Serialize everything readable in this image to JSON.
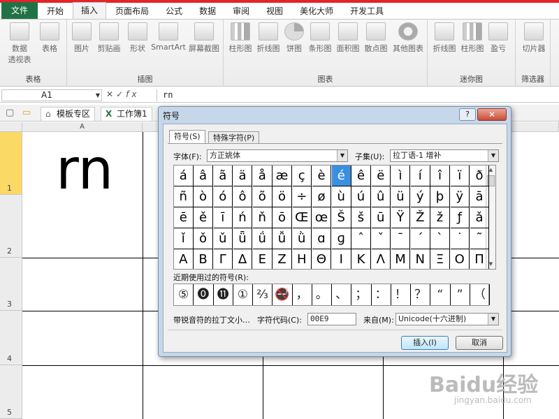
{
  "ribbon_tabs": [
    "文件",
    "开始",
    "插入",
    "页面布局",
    "公式",
    "数据",
    "审阅",
    "视图",
    "美化大师",
    "开发工具"
  ],
  "ribbon_groups": {
    "tables": {
      "label": "表格",
      "buttons": [
        "数据\n透视表",
        "表格"
      ]
    },
    "illustrations": {
      "label": "插图",
      "buttons": [
        "图片",
        "剪贴画",
        "形状",
        "SmartArt",
        "屏幕截图"
      ]
    },
    "charts": {
      "label": "图表",
      "buttons": [
        "柱形图",
        "折线图",
        "饼图",
        "条形图",
        "面积图",
        "散点图",
        "其他图表"
      ]
    },
    "sparklines": {
      "label": "迷你图",
      "buttons": [
        "折线图",
        "柱形图",
        "盈亏"
      ]
    },
    "filter": {
      "label": "筛选器",
      "buttons": [
        "切片器"
      ]
    }
  },
  "formula_bar": {
    "name_box": "A1",
    "fx": "fx",
    "value": "rn"
  },
  "tab_strip": {
    "template": "模板专区",
    "workbook": "工作簿1"
  },
  "sheet": {
    "col_header": "A",
    "rows": [
      "1",
      "2",
      "3",
      "4",
      "5"
    ],
    "a1_value": "rn"
  },
  "dialog": {
    "title": "符号",
    "help_label": "?",
    "close_label": "✕",
    "tab_symbols": "符号(S)",
    "tab_special": "特殊字符(P)",
    "font_label": "字体(F):",
    "font_value": "方正姚体",
    "subset_label": "子集(U):",
    "subset_value": "拉丁语-1 增补",
    "symbols": [
      [
        "á",
        "â",
        "ã",
        "ä",
        "å",
        "æ",
        "ç",
        "è",
        "é",
        "ê",
        "ë",
        "ì",
        "í",
        "î",
        "ï",
        "ð"
      ],
      [
        "ñ",
        "ò",
        "ó",
        "ô",
        "õ",
        "ö",
        "÷",
        "ø",
        "ù",
        "ú",
        "û",
        "ü",
        "ý",
        "þ",
        "ÿ",
        "ā"
      ],
      [
        "ē",
        "ě",
        "ī",
        "ń",
        "ň",
        "ō",
        "Œ",
        "œ",
        "Š",
        "š",
        "ū",
        "Ÿ",
        "Ž",
        "ž",
        "ƒ",
        "ǎ"
      ],
      [
        "ǐ",
        "ǒ",
        "ǔ",
        "ǖ",
        "ǘ",
        "ǚ",
        "ǜ",
        "ɑ",
        "ɡ",
        "ˆ",
        "ˇ",
        "ˉ",
        "ˊ",
        "ˋ",
        "˙",
        "˜"
      ],
      [
        "Α",
        "Β",
        "Γ",
        "Δ",
        "Ε",
        "Ζ",
        "Η",
        "Θ",
        "Ι",
        "Κ",
        "Λ",
        "Μ",
        "Ν",
        "Ξ",
        "Ο",
        "Π"
      ]
    ],
    "selected_symbol": "é",
    "recent_label": "近期使用过的符号(R):",
    "recent": [
      "⑤",
      "⓿",
      "⓫",
      "①",
      "⅔",
      "🚭",
      "，",
      "。",
      "、",
      "；",
      "：",
      "！",
      "？",
      "“",
      "”",
      "（"
    ],
    "char_name": "带锐音符的拉丁文小…",
    "code_label": "字符代码(C):",
    "code_value": "00E9",
    "from_label": "来自(M):",
    "from_value": "Unicode(十六进制)",
    "insert_label": "插入(I)",
    "cancel_label": "取消"
  },
  "watermark": {
    "brand": "Baidu经验",
    "url": "jingyan.baidu.com"
  }
}
